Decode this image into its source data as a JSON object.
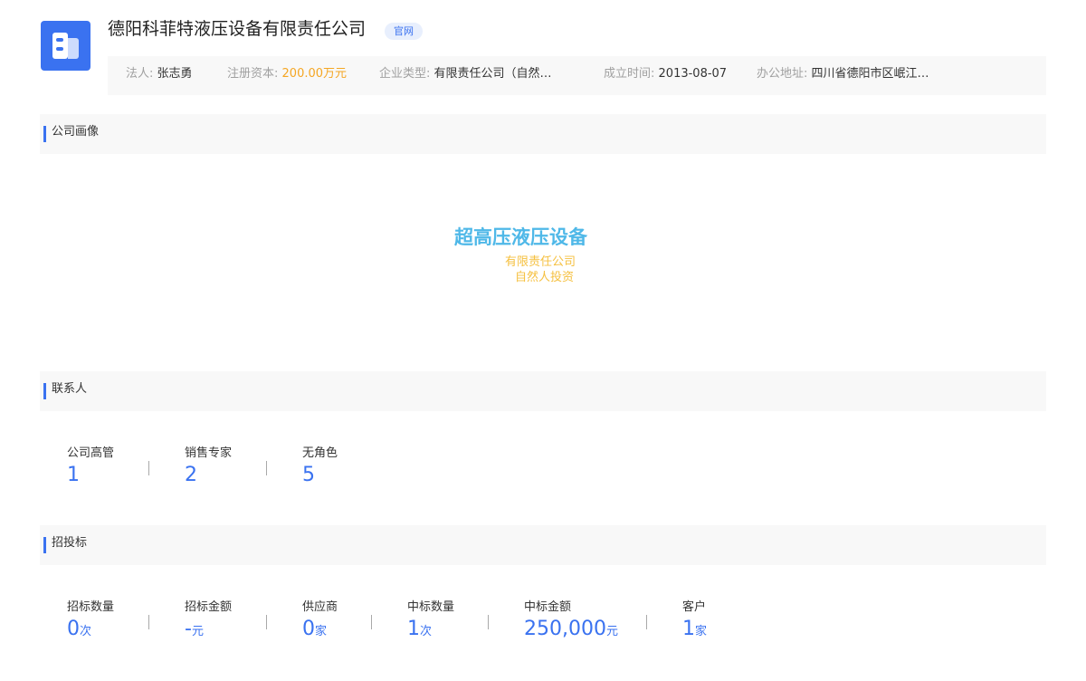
{
  "company": {
    "name": "德阳科菲特液压设备有限责任公司",
    "official_tag": "官网"
  },
  "info": {
    "legal_rep_label": "法人:",
    "legal_rep_value": "张志勇",
    "capital_label": "注册资本:",
    "capital_value": "200.00万元",
    "type_label": "企业类型:",
    "type_value": "有限责任公司（自然…",
    "founded_label": "成立时间:",
    "founded_value": "2013-08-07",
    "address_label": "办公地址:",
    "address_value": "四川省德阳市区岷江…"
  },
  "portrait": {
    "title": "公司画像",
    "words": [
      "超高压液压设备",
      "有限责任公司",
      "自然人投资"
    ]
  },
  "contacts": {
    "title": "联系人",
    "stats": [
      {
        "label": "公司高管",
        "value": "1"
      },
      {
        "label": "销售专家",
        "value": "2"
      },
      {
        "label": "无角色",
        "value": "5"
      }
    ]
  },
  "bidding": {
    "title": "招投标",
    "stats": [
      {
        "label": "招标数量",
        "value": "0",
        "unit": "次"
      },
      {
        "label": "招标金额",
        "value": "-",
        "unit": "元"
      },
      {
        "label": "供应商",
        "value": "0",
        "unit": "家"
      },
      {
        "label": "中标数量",
        "value": "1",
        "unit": "次"
      },
      {
        "label": "中标金额",
        "value": "250,000",
        "unit": "元"
      },
      {
        "label": "客户",
        "value": "1",
        "unit": "家"
      }
    ]
  },
  "colors": {
    "accent": "#3a72f0",
    "capital": "#f5a623",
    "wordcloud_primary": "#4fb8e8",
    "wordcloud_secondary": "#f5c040"
  }
}
